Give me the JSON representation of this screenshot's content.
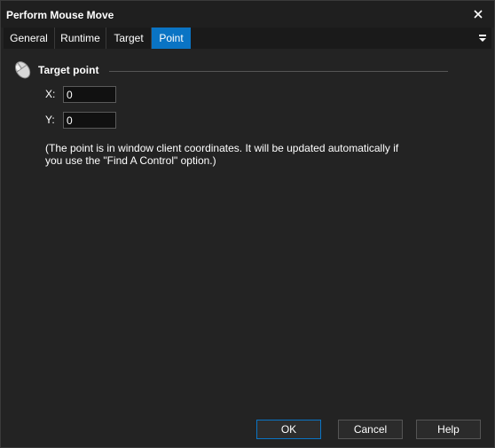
{
  "window": {
    "title": "Perform Mouse Move"
  },
  "tabs": [
    {
      "label": "General",
      "active": false
    },
    {
      "label": "Runtime",
      "active": false
    },
    {
      "label": "Target",
      "active": false
    },
    {
      "label": "Point",
      "active": true
    }
  ],
  "group": {
    "label": "Target point",
    "icon": "mouse-icon"
  },
  "fields": {
    "x": {
      "label": "X:",
      "value": "0"
    },
    "y": {
      "label": "Y:",
      "value": "0"
    }
  },
  "note": "(The point is in window client coordinates. It will be updated automatically if you use the \"Find A Control\" option.)",
  "buttons": {
    "ok": "OK",
    "cancel": "Cancel",
    "help": "Help"
  },
  "colors": {
    "accent": "#0a74c4",
    "background": "#232323"
  }
}
